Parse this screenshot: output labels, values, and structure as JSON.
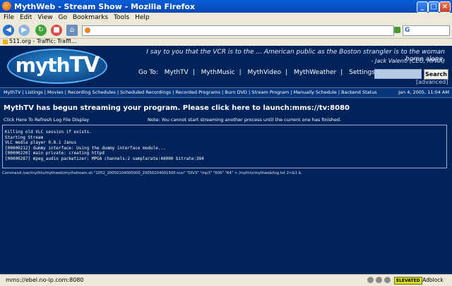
{
  "window": {
    "title": "MythWeb - Stream Show - Mozilla Firefox",
    "minimize": "_",
    "maximize": "□",
    "close": "×"
  },
  "menu": [
    "File",
    "Edit",
    "View",
    "Go",
    "Bookmarks",
    "Tools",
    "Help"
  ],
  "bookmarks": {
    "item": "511.org - Traffic: Traffi..."
  },
  "header": {
    "logo": {
      "part1": "myth",
      "part2": "TV"
    },
    "quote": "I say to you that the VCR is to the ... American public as the Boston strangler is to the woman home alone.",
    "author": "- Jack Valenti (CEO, MPAA)",
    "nav": {
      "goto": "Go To:",
      "items": [
        "MythTV",
        "MythMusic",
        "MythVideo",
        "MythWeather",
        "Settings"
      ],
      "sep": "|"
    },
    "search_button": "Search",
    "advanced": "[advanced]"
  },
  "subnav": {
    "items": [
      "MythTV",
      "Listings",
      "Movies",
      "Recording Schedules",
      "Scheduled Recordings",
      "Recorded Programs",
      "Burn DVD",
      "Stream Program",
      "Manually Schedule",
      "Backend Status"
    ],
    "sep": " | ",
    "datetime": "Jan 4, 2005, 11:04 AM"
  },
  "main": {
    "headline": "MythTV has begun streaming your program. Please click here to launch:mms://tv:8080",
    "refresh": "Click Here To Refresh Log File Display",
    "note": "Note: You cannot start streaming another process until the current one has finished.",
    "log": [
      "Killing old VLC session if exists.",
      "Starting Stream",
      "VLC media player 0.8.1 Janus",
      "[00000212] dummy interface: Using the dummy interface module...",
      "[00000220] main private: creating httpd",
      "[00000287] mpeg_audio packetizer: MPGA channels:2 samplerate:48000 bitrate:384"
    ],
    "command": "Command /var/mythtv/mythweb/mythstream.sh \"1052_20050104000000_20050104001500.nuv\" \"DIV3\" \"mp3\" \"600\" \"64\" > /mythtv/mythweb/log.txt 2>&1 &"
  },
  "status": {
    "text": "mms://ebel.no-ip.com:8080",
    "badge": "ELEVATED",
    "adblock": "Adblock"
  },
  "colors": {
    "page_bg": "#00235a",
    "titlebar": "#0a5fd8"
  }
}
